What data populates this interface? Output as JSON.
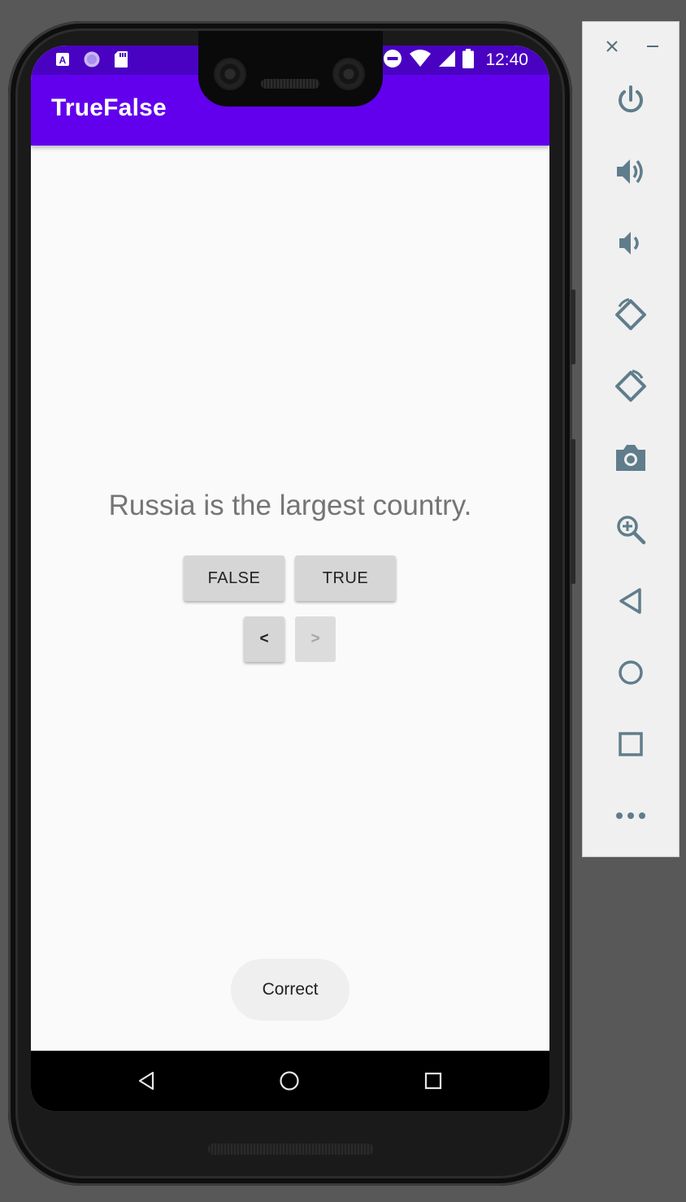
{
  "app": {
    "title": "TrueFalse",
    "question": "Russia is the largest country.",
    "false_label": "FALSE",
    "true_label": "TRUE",
    "prev_label": "<",
    "next_label": ">",
    "toast": "Correct"
  },
  "status_bar": {
    "time": "12:40",
    "left_icons": [
      "accessibility-a-icon",
      "circle-notification-icon",
      "sd-card-icon"
    ],
    "right_icons": [
      "do-not-disturb-icon",
      "wifi-icon",
      "cell-signal-icon",
      "battery-icon"
    ]
  },
  "nav_bar": {
    "icons": [
      "back-icon",
      "home-icon",
      "recents-icon"
    ]
  },
  "emulator_toolbar": {
    "icons": [
      "close-icon",
      "minimize-icon",
      "power-icon",
      "volume-up-icon",
      "volume-down-icon",
      "rotate-left-icon",
      "rotate-right-icon",
      "camera-icon",
      "zoom-icon",
      "back-icon",
      "home-icon",
      "overview-icon",
      "more-icon"
    ]
  },
  "colors": {
    "primary": "#6200ee",
    "primary_dark": "#4a02c2",
    "background": "#fafafa",
    "button": "#d6d6d6",
    "toolbar_icon": "#607d8b",
    "emulator_background": "#585858"
  }
}
